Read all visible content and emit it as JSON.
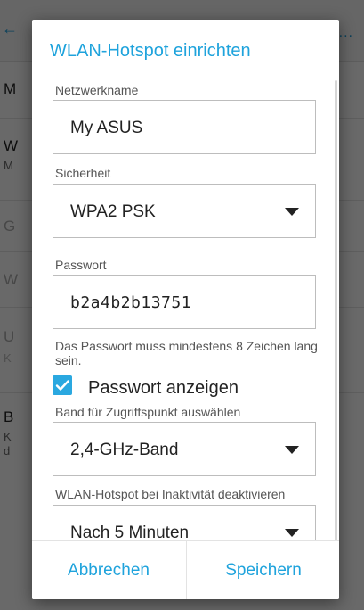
{
  "background": {
    "letters": [
      "M",
      "W",
      "M",
      "G",
      "W",
      "U",
      "K",
      "B",
      "K",
      "d"
    ],
    "dots": "..."
  },
  "dialog": {
    "title": "WLAN-Hotspot einrichten",
    "network_name": {
      "label": "Netzwerkname",
      "value": "My ASUS"
    },
    "security": {
      "label": "Sicherheit",
      "value": "WPA2 PSK"
    },
    "password": {
      "label": "Passwort",
      "value": "b2a4b2b13751",
      "hint": "Das Passwort muss mindestens 8 Zeichen lang sein.",
      "show_label": "Passwort anzeigen",
      "show_checked": true
    },
    "band": {
      "label": "Band für Zugriffspunkt auswählen",
      "value": "2,4-GHz-Band"
    },
    "inactivity": {
      "label": "WLAN-Hotspot bei Inaktivität deaktivieren",
      "value": "Nach 5 Minuten"
    },
    "cancel_label": "Abbrechen",
    "save_label": "Speichern"
  },
  "colors": {
    "accent": "#1fa3dc",
    "checkbox": "#2aa8e0"
  }
}
